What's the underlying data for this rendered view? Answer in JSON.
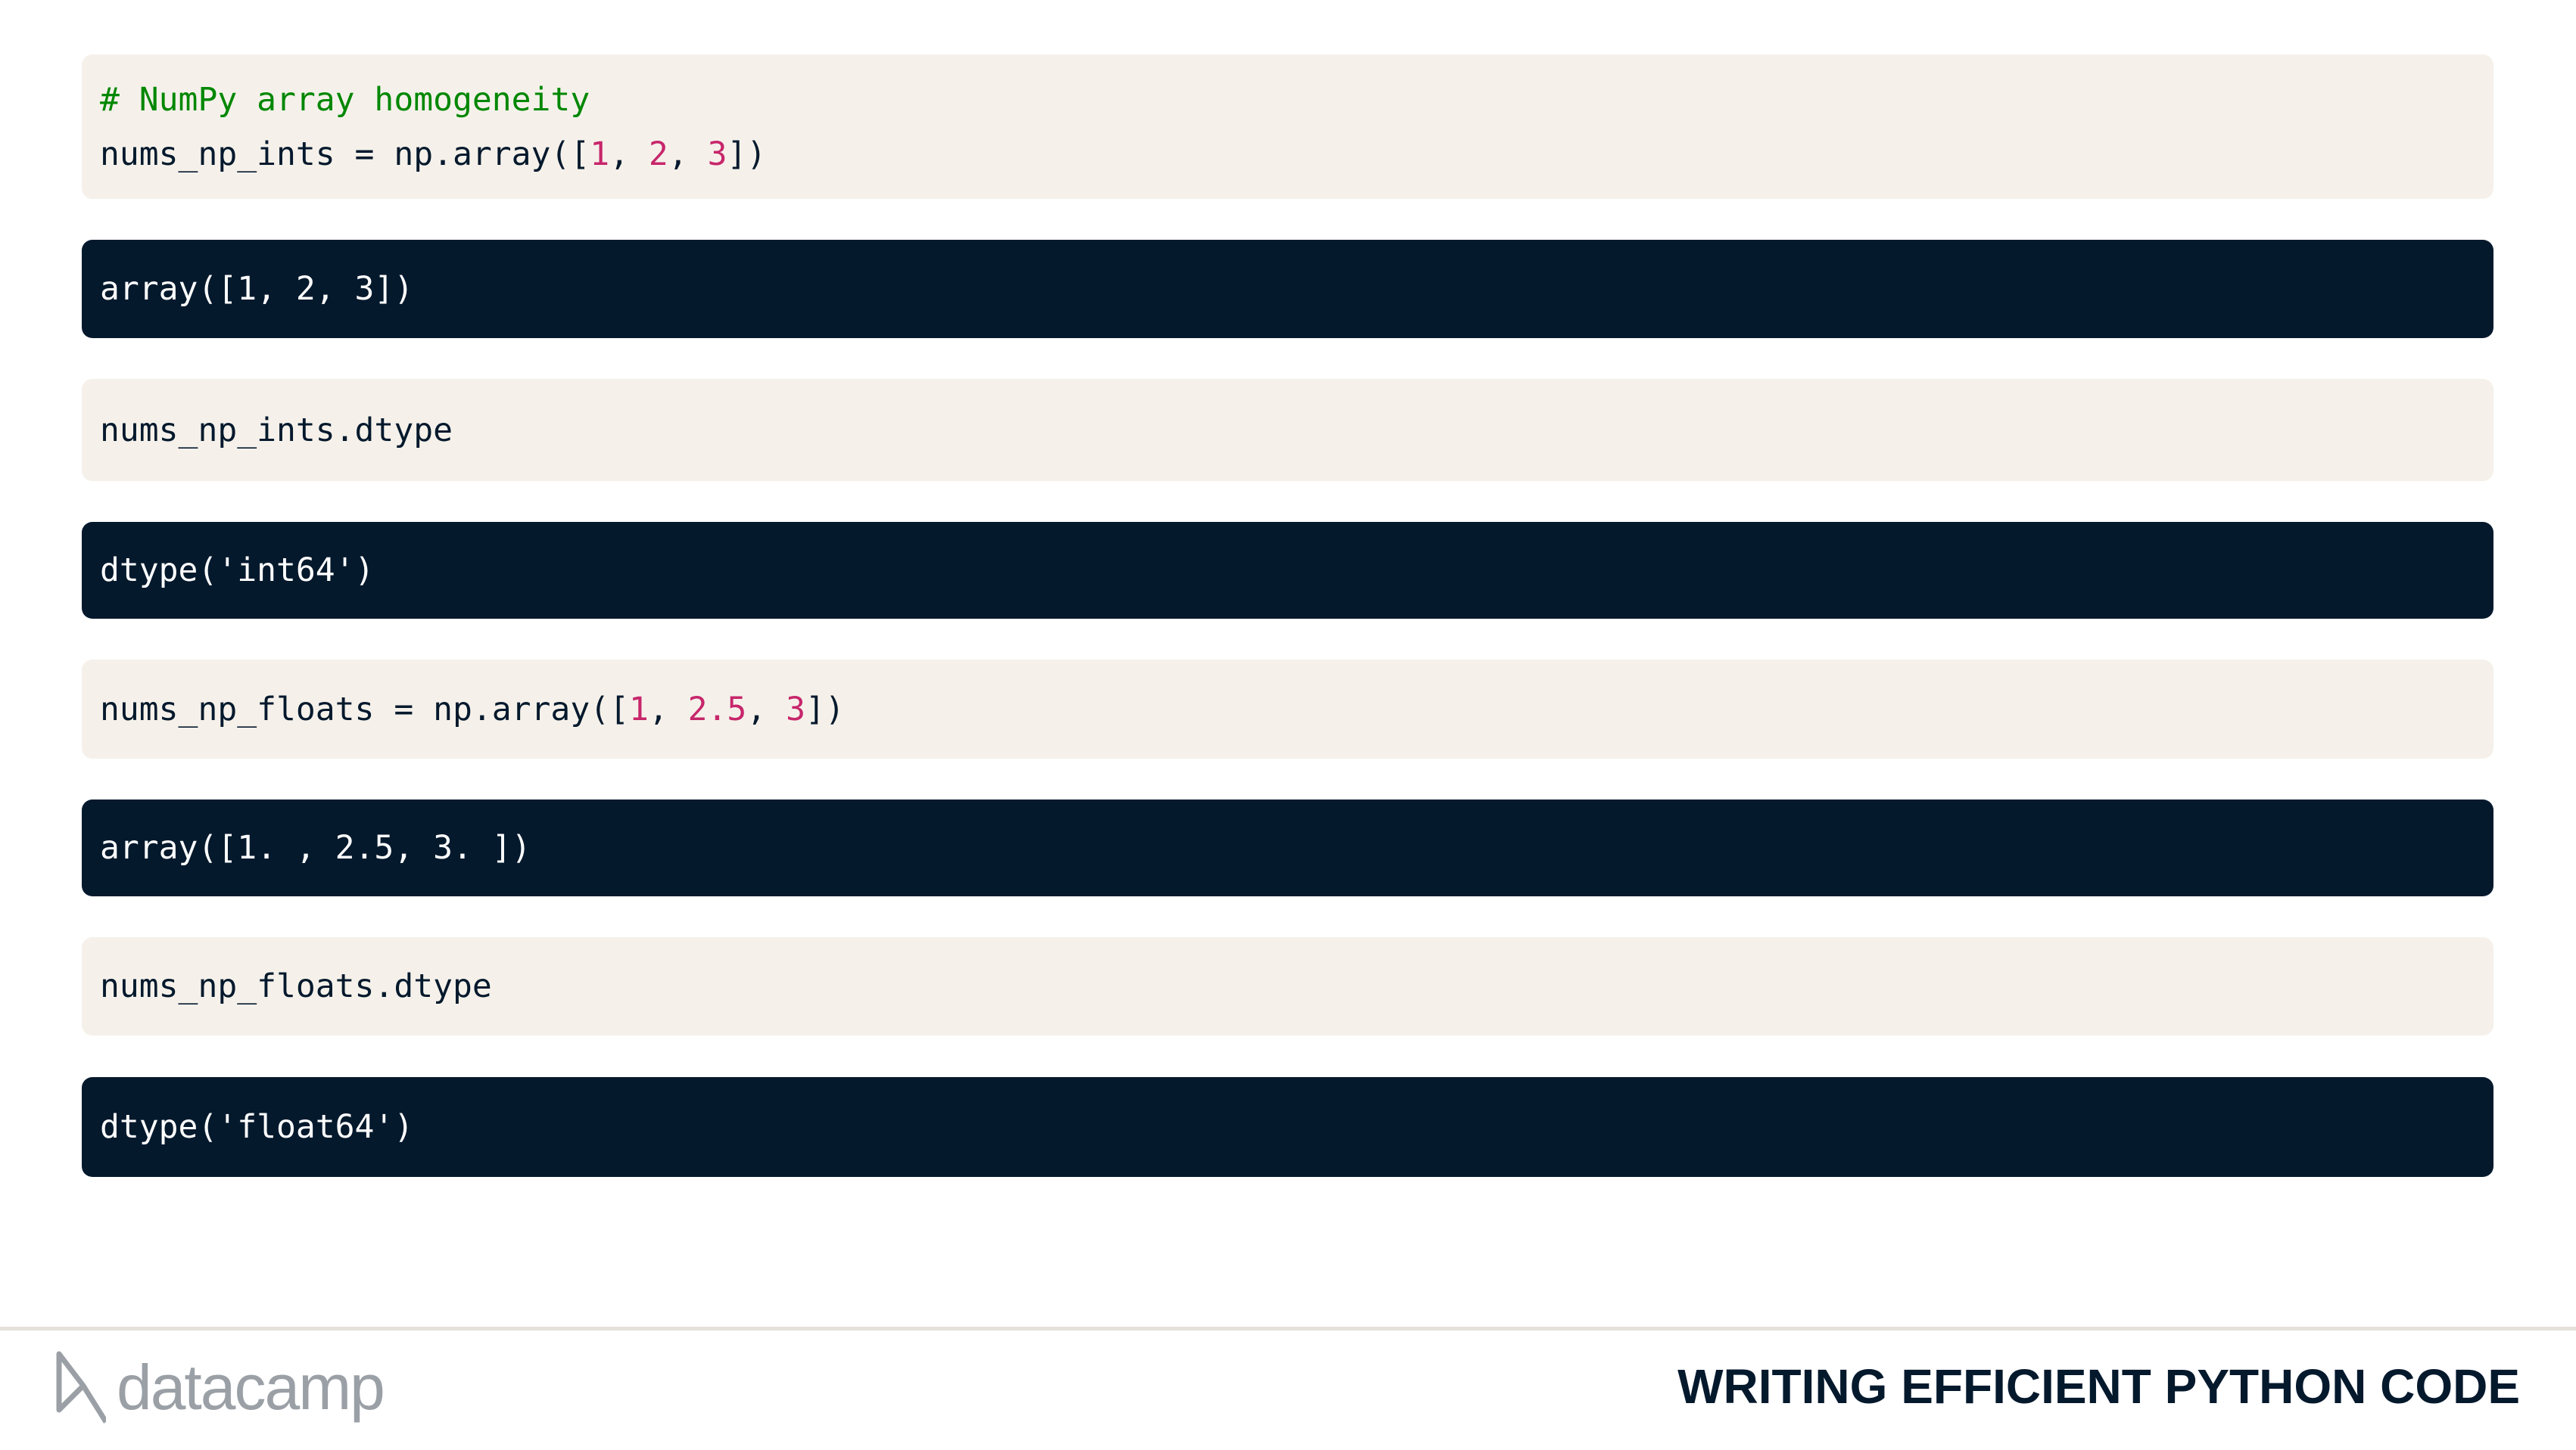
{
  "cells": [
    {
      "type": "input",
      "lines": [
        [
          {
            "t": "# NumPy array homogeneity",
            "c": "comment"
          }
        ],
        [
          {
            "t": "nums_np_ints = np.array([",
            "c": "code"
          },
          {
            "t": "1",
            "c": "number"
          },
          {
            "t": ", ",
            "c": "code"
          },
          {
            "t": "2",
            "c": "number"
          },
          {
            "t": ", ",
            "c": "code"
          },
          {
            "t": "3",
            "c": "number"
          },
          {
            "t": "])",
            "c": "code"
          }
        ]
      ]
    },
    {
      "type": "output",
      "lines": [
        [
          {
            "t": "array([1, 2, 3])",
            "c": "code"
          }
        ]
      ]
    },
    {
      "type": "input",
      "lines": [
        [
          {
            "t": "nums_np_ints.dtype",
            "c": "code"
          }
        ]
      ]
    },
    {
      "type": "output",
      "lines": [
        [
          {
            "t": "dtype('int64')",
            "c": "code"
          }
        ]
      ]
    },
    {
      "type": "input",
      "lines": [
        [
          {
            "t": "nums_np_floats = np.array([",
            "c": "code"
          },
          {
            "t": "1",
            "c": "number"
          },
          {
            "t": ", ",
            "c": "code"
          },
          {
            "t": "2.5",
            "c": "number"
          },
          {
            "t": ", ",
            "c": "code"
          },
          {
            "t": "3",
            "c": "number"
          },
          {
            "t": "])",
            "c": "code"
          }
        ]
      ]
    },
    {
      "type": "output",
      "lines": [
        [
          {
            "t": "array([1. , 2.5, 3. ])",
            "c": "code"
          }
        ]
      ]
    },
    {
      "type": "input",
      "lines": [
        [
          {
            "t": "nums_np_floats.dtype",
            "c": "code"
          }
        ]
      ]
    },
    {
      "type": "output",
      "lines": [
        [
          {
            "t": "dtype('float64')",
            "c": "code"
          }
        ]
      ]
    }
  ],
  "footer": {
    "logo_text": "datacamp",
    "course_title": "WRITING EFFICIENT PYTHON CODE"
  },
  "colors": {
    "input_bg": "#f5f1ea",
    "output_bg": "#05192d",
    "comment": "#008700",
    "number": "#c7266b"
  }
}
